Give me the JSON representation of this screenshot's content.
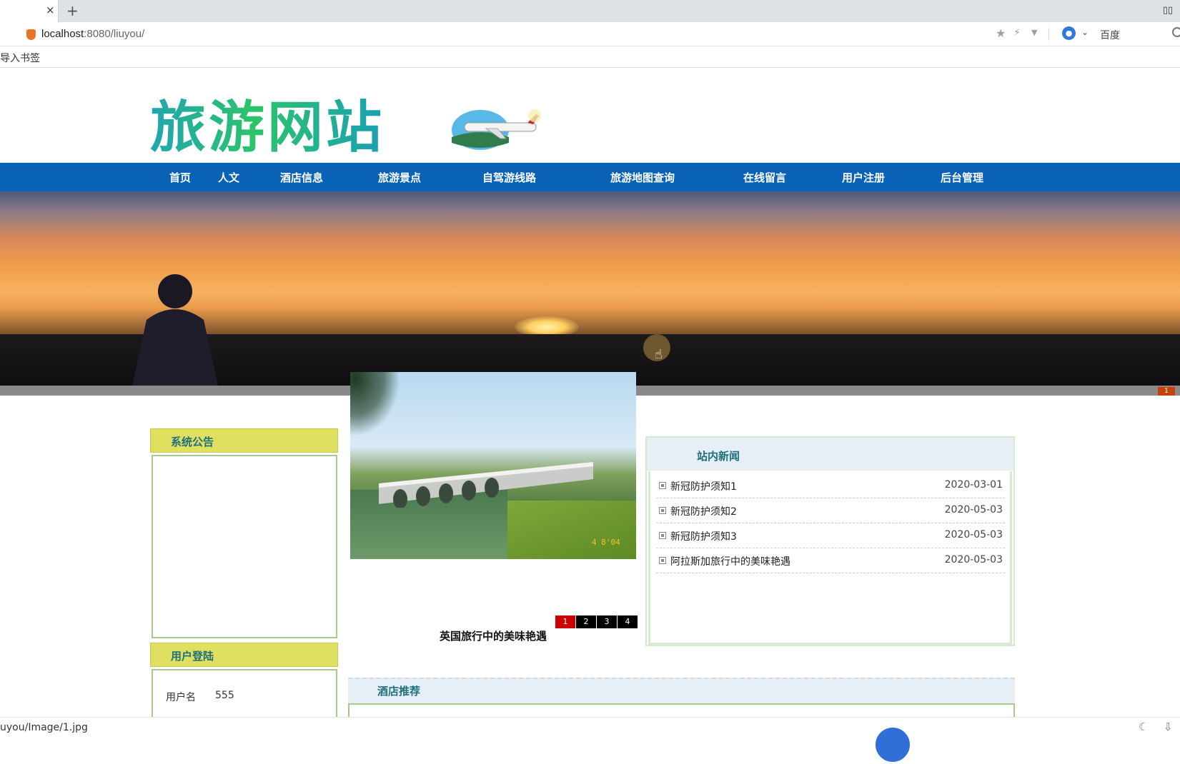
{
  "browser": {
    "tab_close": "×",
    "new_tab": "+",
    "url_host": "localhost",
    "url_rest": ":8080/liuyou/",
    "search_engine": "百度",
    "bookmark_import": "导入书签",
    "status_url": "uyou/Image/1.jpg"
  },
  "site": {
    "logo_text": "旅游网站",
    "nav": [
      "首页",
      "人文",
      "酒店信息",
      "旅游景点",
      "自驾游线路",
      "旅游地图查询",
      "在线留言",
      "用户注册",
      "后台管理"
    ],
    "banner_index": "1"
  },
  "sidebar": {
    "notice_title": "系统公告",
    "login_title": "用户登陆",
    "username_label": "用户名",
    "username_value": "555"
  },
  "slideshow": {
    "caption": "英国旅行中的美味艳遇",
    "date_stamp": "4 8'04",
    "pages": [
      "1",
      "2",
      "3",
      "4"
    ],
    "active_page": "1"
  },
  "news": {
    "title": "站内新闻",
    "items": [
      {
        "title": "新冠防护须知1",
        "date": "2020-03-01"
      },
      {
        "title": "新冠防护须知2",
        "date": "2020-05-03"
      },
      {
        "title": "新冠防护须知3",
        "date": "2020-05-03"
      },
      {
        "title": "阿拉斯加旅行中的美味艳遇",
        "date": "2020-05-03"
      }
    ]
  },
  "hotel": {
    "title": "酒店推荐"
  }
}
